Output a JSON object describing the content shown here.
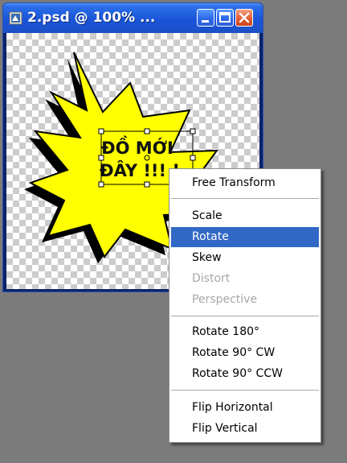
{
  "window": {
    "title": "2.psd @ 100% ..."
  },
  "canvas_text": {
    "line1": "ĐỒ MỚI",
    "line2": "ĐÂY !!! !"
  },
  "menu": {
    "free_transform": "Free Transform",
    "scale": "Scale",
    "rotate": "Rotate",
    "skew": "Skew",
    "distort": "Distort",
    "perspective": "Perspective",
    "rotate_180": "Rotate 180°",
    "rotate_90_cw": "Rotate 90° CW",
    "rotate_90_ccw": "Rotate 90° CCW",
    "flip_horizontal": "Flip Horizontal",
    "flip_vertical": "Flip Vertical"
  },
  "colors": {
    "burst_fill": "#ffff00",
    "menu_highlight": "#3168c6",
    "titlebar": "#1a55d9"
  }
}
